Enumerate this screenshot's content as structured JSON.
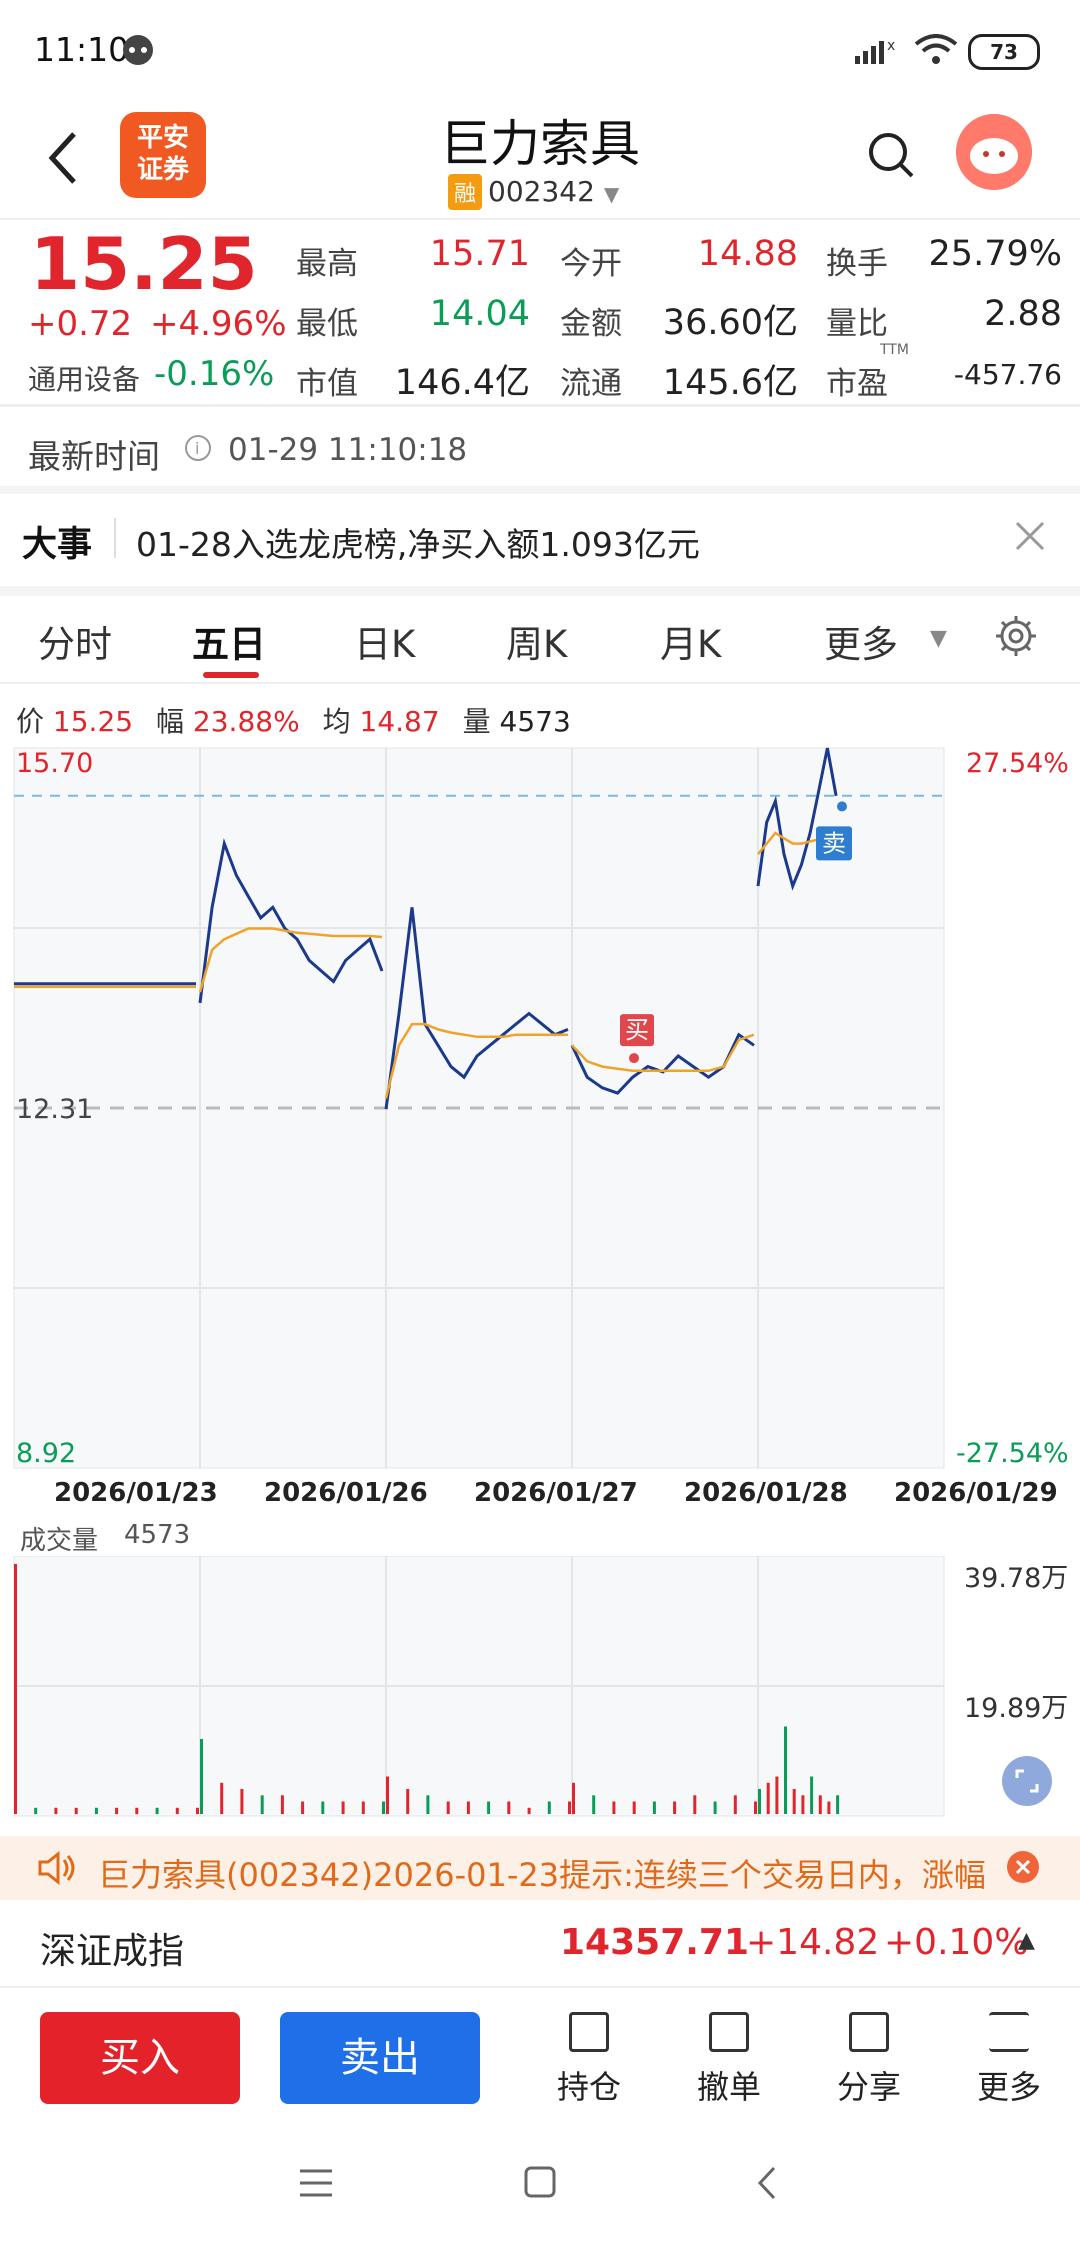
{
  "status": {
    "time": "11:10",
    "battery": "73"
  },
  "header": {
    "logo_line1": "平安",
    "logo_line2": "证券",
    "title": "巨力索具",
    "badge": "融",
    "code": "002342"
  },
  "quote": {
    "price": "15.25",
    "change": "+0.72",
    "change_pct": "+4.96%",
    "sector_name": "通用设备",
    "sector_pct": "-0.16%",
    "high_label": "最高",
    "high": "15.71",
    "low_label": "最低",
    "low": "14.04",
    "mcap_label": "市值",
    "mcap": "146.4亿",
    "open_label": "今开",
    "open": "14.88",
    "amount_label": "金额",
    "amount": "36.60亿",
    "float_label": "流通",
    "float": "145.6亿",
    "turnover_label": "换手",
    "turnover": "25.79%",
    "vr_label": "量比",
    "vr": "2.88",
    "pe_label": "市盈",
    "pe_sup": "TTM",
    "pe": "-457.76"
  },
  "update": {
    "label": "最新时间",
    "time": "01-29 11:10:18"
  },
  "news": {
    "tag": "大事",
    "text": "01-28入选龙虎榜,净买入额1.093亿元"
  },
  "tabs": [
    "分时",
    "五日",
    "日K",
    "周K",
    "月K",
    "更多"
  ],
  "chart_info": {
    "price_label": "价",
    "price": "15.25",
    "range_label": "幅",
    "range": "23.88%",
    "avg_label": "均",
    "avg": "14.87",
    "vol_label": "量",
    "vol": "4573"
  },
  "chart_data": {
    "type": "line",
    "x": [
      "2026/01/23",
      "2026/01/26",
      "2026/01/27",
      "2026/01/28",
      "2026/01/29"
    ],
    "y_top": "15.70",
    "y_mid": "12.31",
    "y_bottom": "8.92",
    "pct_top": "27.54%",
    "pct_bottom": "-27.54%",
    "ylim": [
      8.92,
      15.7
    ],
    "series": [
      {
        "values": [
          13.48,
          13.48,
          13.48,
          13.48,
          13.48,
          13.48,
          13.48,
          13.48,
          13.3,
          14.2,
          14.8,
          14.5,
          14.3,
          14.1,
          14.2,
          14.0,
          13.9,
          13.7,
          13.6,
          13.5,
          13.7,
          13.8,
          13.9,
          13.6,
          12.3,
          13.2,
          14.2,
          13.1,
          12.9,
          12.7,
          12.6,
          12.8,
          12.9,
          13.0,
          13.1,
          13.2,
          13.1,
          13.0,
          13.05,
          12.9,
          12.6,
          12.5,
          12.45,
          12.6,
          12.7,
          12.65,
          12.8,
          12.7,
          12.6,
          12.7,
          13.0,
          12.9,
          14.4,
          15.0,
          15.2,
          14.7,
          14.4,
          14.6,
          14.9,
          15.3,
          15.7,
          15.25
        ]
      },
      {
        "values": [
          13.45,
          13.45,
          13.45,
          13.45,
          13.45,
          13.45,
          13.45,
          13.45,
          13.4,
          13.8,
          13.9,
          13.95,
          14.0,
          14.0,
          14.0,
          13.98,
          13.96,
          13.95,
          13.94,
          13.93,
          13.93,
          13.93,
          13.93,
          13.92,
          12.4,
          12.9,
          13.1,
          13.1,
          13.05,
          13.02,
          13.0,
          12.98,
          12.98,
          12.98,
          13.0,
          13.0,
          13.0,
          13.0,
          13.0,
          12.9,
          12.75,
          12.7,
          12.68,
          12.66,
          12.66,
          12.66,
          12.66,
          12.66,
          12.66,
          12.7,
          12.95,
          13.0,
          14.7,
          14.8,
          14.9,
          14.85,
          14.8,
          14.8,
          14.82,
          14.84,
          14.86,
          14.87
        ]
      }
    ],
    "markers": [
      {
        "label": "买",
        "day": "2026/01/28"
      },
      {
        "label": "卖",
        "day": "2026/01/29"
      }
    ],
    "volume": {
      "label": "成交量",
      "value": "4573",
      "y_top": "39.78万",
      "y_mid": "19.89万",
      "bars": [
        40,
        1,
        1,
        1,
        1,
        1,
        1,
        1,
        1,
        1,
        12,
        5,
        4,
        3,
        3,
        2,
        2,
        2,
        2,
        2,
        6,
        4,
        3,
        2,
        2,
        2,
        2,
        1,
        2,
        2,
        5,
        3,
        2,
        2,
        2,
        2,
        3,
        2,
        3,
        2,
        4,
        5,
        6,
        14,
        4,
        3,
        6,
        3,
        2,
        3
      ]
    }
  },
  "tip": {
    "text": "巨力索具(002342)2026-01-23提示:连续三个交易日内，涨幅"
  },
  "index": {
    "name": "深证成指",
    "value": "14357.71",
    "change": "+14.82",
    "pct": "+0.10%"
  },
  "actions": {
    "buy": "买入",
    "sell": "卖出",
    "hold": "持仓",
    "cancel": "撤单",
    "share": "分享",
    "more": "更多"
  }
}
